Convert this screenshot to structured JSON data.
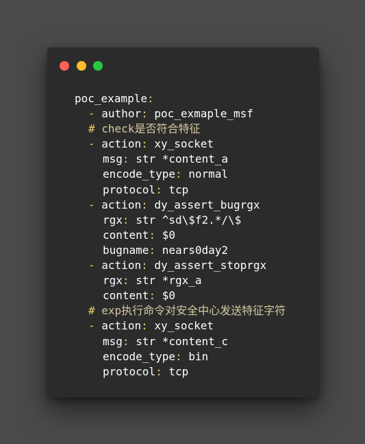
{
  "colors": {
    "background": "#4a4a4a",
    "window": "#2b2b2b",
    "text": "#ffffff",
    "punctuation": "#e6cd69",
    "comment": "#d4c9a0",
    "close": "#ff5f56",
    "minimize": "#ffbd2e",
    "maximize": "#27c93f"
  },
  "window_controls": [
    "close",
    "minimize",
    "maximize"
  ],
  "code": {
    "lines": [
      {
        "indent": 0,
        "kind": "mapkey",
        "key": "poc_example",
        "colon": ":"
      },
      {
        "indent": 1,
        "kind": "item",
        "dash": "-",
        "key": "author",
        "colon": ":",
        "value": "poc_exmaple_msf"
      },
      {
        "indent": 1,
        "kind": "comment",
        "hash": "#",
        "text": "check是否符合特征"
      },
      {
        "indent": 1,
        "kind": "item",
        "dash": "-",
        "key": "action",
        "colon": ":",
        "value": "xy_socket"
      },
      {
        "indent": 2,
        "kind": "pair",
        "key": "msg",
        "colon": ":",
        "value": "str *content_a"
      },
      {
        "indent": 2,
        "kind": "pair",
        "key": "encode_type",
        "colon": ":",
        "value": "normal"
      },
      {
        "indent": 2,
        "kind": "pair",
        "key": "protocol",
        "colon": ":",
        "value": "tcp"
      },
      {
        "indent": 1,
        "kind": "item",
        "dash": "-",
        "key": "action",
        "colon": ":",
        "value": "dy_assert_bugrgx"
      },
      {
        "indent": 2,
        "kind": "pair",
        "key": "rgx",
        "colon": ":",
        "value": "str ^sd\\$f2.*/\\$"
      },
      {
        "indent": 2,
        "kind": "pair",
        "key": "content",
        "colon": ":",
        "value": "$0"
      },
      {
        "indent": 2,
        "kind": "pair",
        "key": "bugname",
        "colon": ":",
        "value": "nears0day2"
      },
      {
        "indent": 1,
        "kind": "item",
        "dash": "-",
        "key": "action",
        "colon": ":",
        "value": "dy_assert_stoprgx"
      },
      {
        "indent": 2,
        "kind": "pair",
        "key": "rgx",
        "colon": ":",
        "value": "str *rgx_a"
      },
      {
        "indent": 2,
        "kind": "pair",
        "key": "content",
        "colon": ":",
        "value": "$0"
      },
      {
        "indent": 1,
        "kind": "comment",
        "hash": "#",
        "text": "exp执行命令对安全中心发送特征字符"
      },
      {
        "indent": 1,
        "kind": "item",
        "dash": "-",
        "key": "action",
        "colon": ":",
        "value": "xy_socket"
      },
      {
        "indent": 2,
        "kind": "pair",
        "key": "msg",
        "colon": ":",
        "value": "str *content_c"
      },
      {
        "indent": 2,
        "kind": "pair",
        "key": "encode_type",
        "colon": ":",
        "value": "bin"
      },
      {
        "indent": 2,
        "kind": "pair",
        "key": "protocol",
        "colon": ":",
        "value": "tcp"
      }
    ]
  }
}
